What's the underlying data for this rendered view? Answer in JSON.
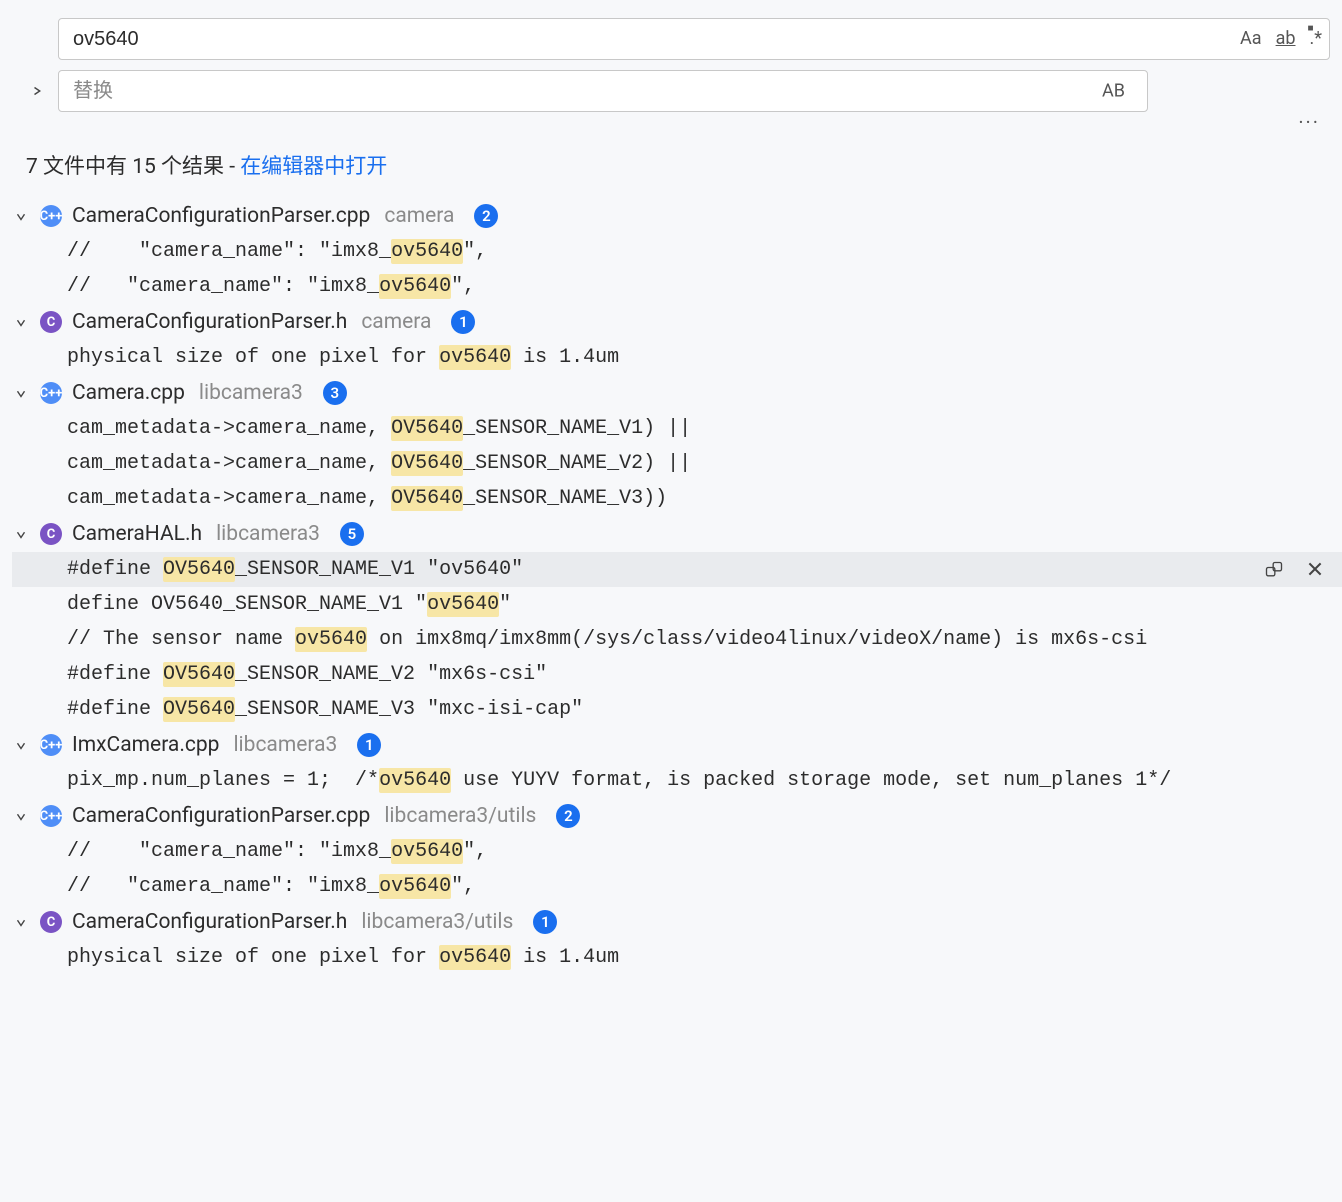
{
  "search": {
    "value": "ov5640",
    "replace_placeholder": "替换",
    "case_label": "Aa",
    "word_label": "ab",
    "regex_label": ".*",
    "preserve_case_label": "AB"
  },
  "summary": {
    "prefix": "7 文件中有 15 个结果 - ",
    "link": "在编辑器中打开"
  },
  "files": [
    {
      "icon": "C++",
      "iconClass": "fi-cpp",
      "name": "CameraConfigurationParser.cpp",
      "path": "camera",
      "count": "2",
      "matches": [
        {
          "text": "//    \"camera_name\": \"imx8_ov5640\",",
          "hl": [
            "ov5640"
          ]
        },
        {
          "text": "//   \"camera_name\": \"imx8_ov5640\",",
          "hl": [
            "ov5640"
          ]
        }
      ]
    },
    {
      "icon": "C",
      "iconClass": "fi-c",
      "name": "CameraConfigurationParser.h",
      "path": "camera",
      "count": "1",
      "matches": [
        {
          "text": "physical size of one pixel for ov5640 is 1.4um",
          "hl": [
            "ov5640"
          ]
        }
      ]
    },
    {
      "icon": "C++",
      "iconClass": "fi-cpp",
      "name": "Camera.cpp",
      "path": "libcamera3",
      "count": "3",
      "matches": [
        {
          "text": "cam_metadata->camera_name, OV5640_SENSOR_NAME_V1) ||",
          "hl": [
            "OV5640"
          ]
        },
        {
          "text": "cam_metadata->camera_name, OV5640_SENSOR_NAME_V2) ||",
          "hl": [
            "OV5640"
          ]
        },
        {
          "text": "cam_metadata->camera_name, OV5640_SENSOR_NAME_V3))",
          "hl": [
            "OV5640"
          ]
        }
      ]
    },
    {
      "icon": "C",
      "iconClass": "fi-h",
      "name": "CameraHAL.h",
      "path": "libcamera3",
      "count": "5",
      "matches": [
        {
          "text": "#define OV5640_SENSOR_NAME_V1 \"ov5640\"",
          "hl": [
            "OV5640"
          ],
          "active": true,
          "actions": true
        },
        {
          "text": "define OV5640_SENSOR_NAME_V1 \"ov5640\"",
          "hl": [
            "ov5640"
          ]
        },
        {
          "text": "// The sensor name ov5640 on imx8mq/imx8mm(/sys/class/video4linux/videoX/name) is mx6s-csi",
          "hl": [
            "ov5640"
          ]
        },
        {
          "text": "#define OV5640_SENSOR_NAME_V2 \"mx6s-csi\"",
          "hl": [
            "OV5640"
          ]
        },
        {
          "text": "#define OV5640_SENSOR_NAME_V3 \"mxc-isi-cap\"",
          "hl": [
            "OV5640"
          ]
        }
      ]
    },
    {
      "icon": "C++",
      "iconClass": "fi-cpp",
      "name": "ImxCamera.cpp",
      "path": "libcamera3",
      "count": "1",
      "matches": [
        {
          "text": "pix_mp.num_planes = 1;  /*ov5640 use YUYV format, is packed storage mode, set num_planes 1*/",
          "hl": [
            "ov5640"
          ]
        }
      ]
    },
    {
      "icon": "C++",
      "iconClass": "fi-cpp",
      "name": "CameraConfigurationParser.cpp",
      "path": "libcamera3/utils",
      "count": "2",
      "matches": [
        {
          "text": "//    \"camera_name\": \"imx8_ov5640\",",
          "hl": [
            "ov5640"
          ]
        },
        {
          "text": "//   \"camera_name\": \"imx8_ov5640\",",
          "hl": [
            "ov5640"
          ]
        }
      ]
    },
    {
      "icon": "C",
      "iconClass": "fi-c",
      "name": "CameraConfigurationParser.h",
      "path": "libcamera3/utils",
      "count": "1",
      "matches": [
        {
          "text": "physical size of one pixel for ov5640 is 1.4um",
          "hl": [
            "ov5640"
          ]
        }
      ]
    }
  ]
}
